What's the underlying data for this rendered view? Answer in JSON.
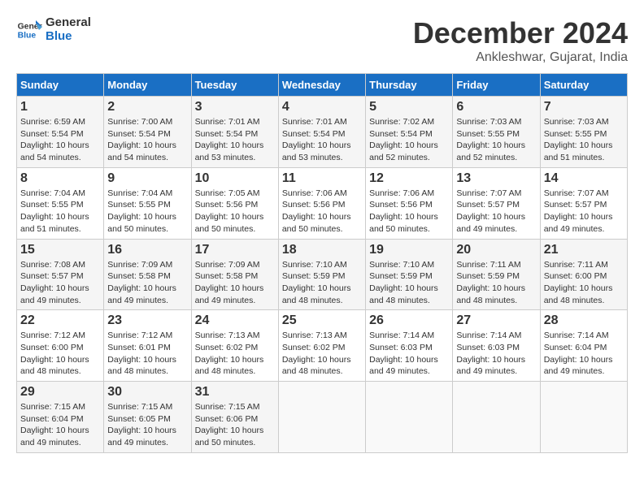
{
  "logo": {
    "line1": "General",
    "line2": "Blue"
  },
  "title": "December 2024",
  "subtitle": "Ankleshwar, Gujarat, India",
  "weekdays": [
    "Sunday",
    "Monday",
    "Tuesday",
    "Wednesday",
    "Thursday",
    "Friday",
    "Saturday"
  ],
  "weeks": [
    [
      {
        "day": 1,
        "sunrise": "6:59 AM",
        "sunset": "5:54 PM",
        "daylight": "10 hours and 54 minutes."
      },
      {
        "day": 2,
        "sunrise": "7:00 AM",
        "sunset": "5:54 PM",
        "daylight": "10 hours and 54 minutes."
      },
      {
        "day": 3,
        "sunrise": "7:01 AM",
        "sunset": "5:54 PM",
        "daylight": "10 hours and 53 minutes."
      },
      {
        "day": 4,
        "sunrise": "7:01 AM",
        "sunset": "5:54 PM",
        "daylight": "10 hours and 53 minutes."
      },
      {
        "day": 5,
        "sunrise": "7:02 AM",
        "sunset": "5:54 PM",
        "daylight": "10 hours and 52 minutes."
      },
      {
        "day": 6,
        "sunrise": "7:03 AM",
        "sunset": "5:55 PM",
        "daylight": "10 hours and 52 minutes."
      },
      {
        "day": 7,
        "sunrise": "7:03 AM",
        "sunset": "5:55 PM",
        "daylight": "10 hours and 51 minutes."
      }
    ],
    [
      {
        "day": 8,
        "sunrise": "7:04 AM",
        "sunset": "5:55 PM",
        "daylight": "10 hours and 51 minutes."
      },
      {
        "day": 9,
        "sunrise": "7:04 AM",
        "sunset": "5:55 PM",
        "daylight": "10 hours and 50 minutes."
      },
      {
        "day": 10,
        "sunrise": "7:05 AM",
        "sunset": "5:56 PM",
        "daylight": "10 hours and 50 minutes."
      },
      {
        "day": 11,
        "sunrise": "7:06 AM",
        "sunset": "5:56 PM",
        "daylight": "10 hours and 50 minutes."
      },
      {
        "day": 12,
        "sunrise": "7:06 AM",
        "sunset": "5:56 PM",
        "daylight": "10 hours and 50 minutes."
      },
      {
        "day": 13,
        "sunrise": "7:07 AM",
        "sunset": "5:57 PM",
        "daylight": "10 hours and 49 minutes."
      },
      {
        "day": 14,
        "sunrise": "7:07 AM",
        "sunset": "5:57 PM",
        "daylight": "10 hours and 49 minutes."
      }
    ],
    [
      {
        "day": 15,
        "sunrise": "7:08 AM",
        "sunset": "5:57 PM",
        "daylight": "10 hours and 49 minutes."
      },
      {
        "day": 16,
        "sunrise": "7:09 AM",
        "sunset": "5:58 PM",
        "daylight": "10 hours and 49 minutes."
      },
      {
        "day": 17,
        "sunrise": "7:09 AM",
        "sunset": "5:58 PM",
        "daylight": "10 hours and 49 minutes."
      },
      {
        "day": 18,
        "sunrise": "7:10 AM",
        "sunset": "5:59 PM",
        "daylight": "10 hours and 48 minutes."
      },
      {
        "day": 19,
        "sunrise": "7:10 AM",
        "sunset": "5:59 PM",
        "daylight": "10 hours and 48 minutes."
      },
      {
        "day": 20,
        "sunrise": "7:11 AM",
        "sunset": "5:59 PM",
        "daylight": "10 hours and 48 minutes."
      },
      {
        "day": 21,
        "sunrise": "7:11 AM",
        "sunset": "6:00 PM",
        "daylight": "10 hours and 48 minutes."
      }
    ],
    [
      {
        "day": 22,
        "sunrise": "7:12 AM",
        "sunset": "6:00 PM",
        "daylight": "10 hours and 48 minutes."
      },
      {
        "day": 23,
        "sunrise": "7:12 AM",
        "sunset": "6:01 PM",
        "daylight": "10 hours and 48 minutes."
      },
      {
        "day": 24,
        "sunrise": "7:13 AM",
        "sunset": "6:02 PM",
        "daylight": "10 hours and 48 minutes."
      },
      {
        "day": 25,
        "sunrise": "7:13 AM",
        "sunset": "6:02 PM",
        "daylight": "10 hours and 48 minutes."
      },
      {
        "day": 26,
        "sunrise": "7:14 AM",
        "sunset": "6:03 PM",
        "daylight": "10 hours and 49 minutes."
      },
      {
        "day": 27,
        "sunrise": "7:14 AM",
        "sunset": "6:03 PM",
        "daylight": "10 hours and 49 minutes."
      },
      {
        "day": 28,
        "sunrise": "7:14 AM",
        "sunset": "6:04 PM",
        "daylight": "10 hours and 49 minutes."
      }
    ],
    [
      {
        "day": 29,
        "sunrise": "7:15 AM",
        "sunset": "6:04 PM",
        "daylight": "10 hours and 49 minutes."
      },
      {
        "day": 30,
        "sunrise": "7:15 AM",
        "sunset": "6:05 PM",
        "daylight": "10 hours and 49 minutes."
      },
      {
        "day": 31,
        "sunrise": "7:15 AM",
        "sunset": "6:06 PM",
        "daylight": "10 hours and 50 minutes."
      },
      null,
      null,
      null,
      null
    ]
  ]
}
